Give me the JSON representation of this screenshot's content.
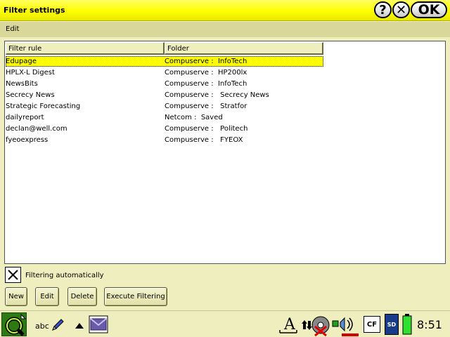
{
  "window": {
    "title": "Filter settings",
    "help_label": "?",
    "close_label": "✕",
    "ok_label": "OK"
  },
  "menu": {
    "edit_label": "Edit"
  },
  "list": {
    "columns": [
      "Filter rule",
      "Folder"
    ],
    "selected_index": 0,
    "rows": [
      {
        "rule": "Edupage",
        "folder": "Compuserve :  InfoTech"
      },
      {
        "rule": "HPLX-L Digest",
        "folder": "Compuserve :  HP200lx"
      },
      {
        "rule": "NewsBits",
        "folder": "Compuserve :  InfoTech"
      },
      {
        "rule": "Secrecy News",
        "folder": "Compuserve :   Secrecy News"
      },
      {
        "rule": "Strategic Forecasting",
        "folder": "Compuserve :   Stratfor"
      },
      {
        "rule": "dailyreport",
        "folder": "Netcom :  Saved"
      },
      {
        "rule": "declan@well.com",
        "folder": "Compuserve :   Politech"
      },
      {
        "rule": "fyeoexpress",
        "folder": "Compuserve :   FYEOX"
      }
    ]
  },
  "options": {
    "filtering_auto_label": "Filtering automatically",
    "filtering_auto_checked": true
  },
  "buttons": {
    "new_label": "New",
    "edit_label": "Edit",
    "delete_label": "Delete",
    "execute_label": "Execute Filtering"
  },
  "taskbar": {
    "clock": "8:51",
    "cf_label": "CF",
    "sd_label": "SD",
    "handwriting_label": "abc",
    "icons": [
      "qtopia-logo-icon",
      "pencil-icon",
      "arrow-up-icon",
      "mail-icon",
      "text-input-icon",
      "network-off-icon",
      "volume-icon",
      "cf-card-icon",
      "sd-card-icon",
      "battery-icon"
    ]
  },
  "colors": {
    "titlebar": "#ffff00",
    "selection": "#ffff00",
    "background": "#efeebe"
  }
}
